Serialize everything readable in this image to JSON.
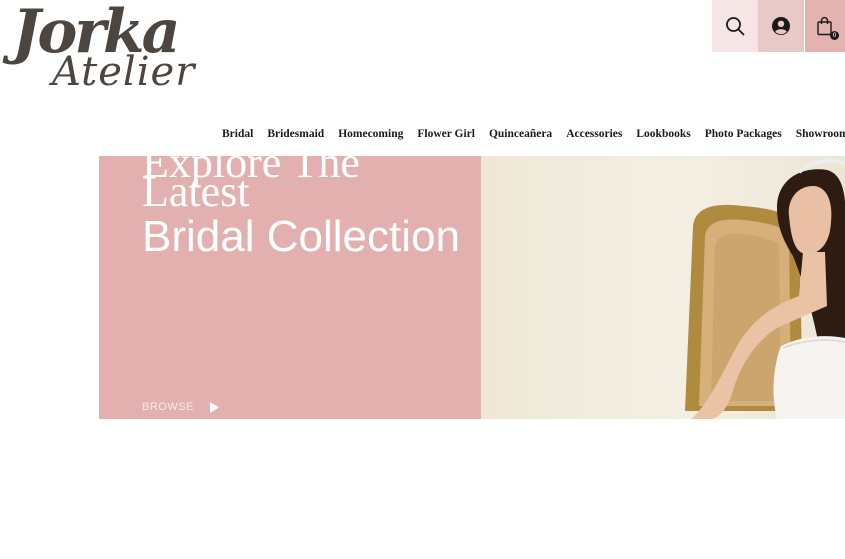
{
  "logo": {
    "main": "Jorka",
    "sub": "Atelier"
  },
  "header": {
    "cart_count": "0"
  },
  "nav": {
    "items": [
      "Bridal",
      "Bridesmaid",
      "Homecoming",
      "Flower Girl",
      "Quinceañera",
      "Accessories",
      "Lookbooks",
      "Photo Packages",
      "Showroom"
    ]
  },
  "hero": {
    "heading_top": "Explore The Latest",
    "heading_main": "Bridal Collection",
    "browse_label": "BROWSE"
  },
  "colors": {
    "hero_pink": "#e3b0b0",
    "logo_brown": "#4d4640",
    "search_bg": "#f5e6e5",
    "account_bg": "#e9c9c8",
    "cart_bg": "#e3b3b1"
  },
  "icons": [
    "search-icon",
    "account-icon",
    "shopping-bag-icon",
    "play-arrow-icon"
  ]
}
